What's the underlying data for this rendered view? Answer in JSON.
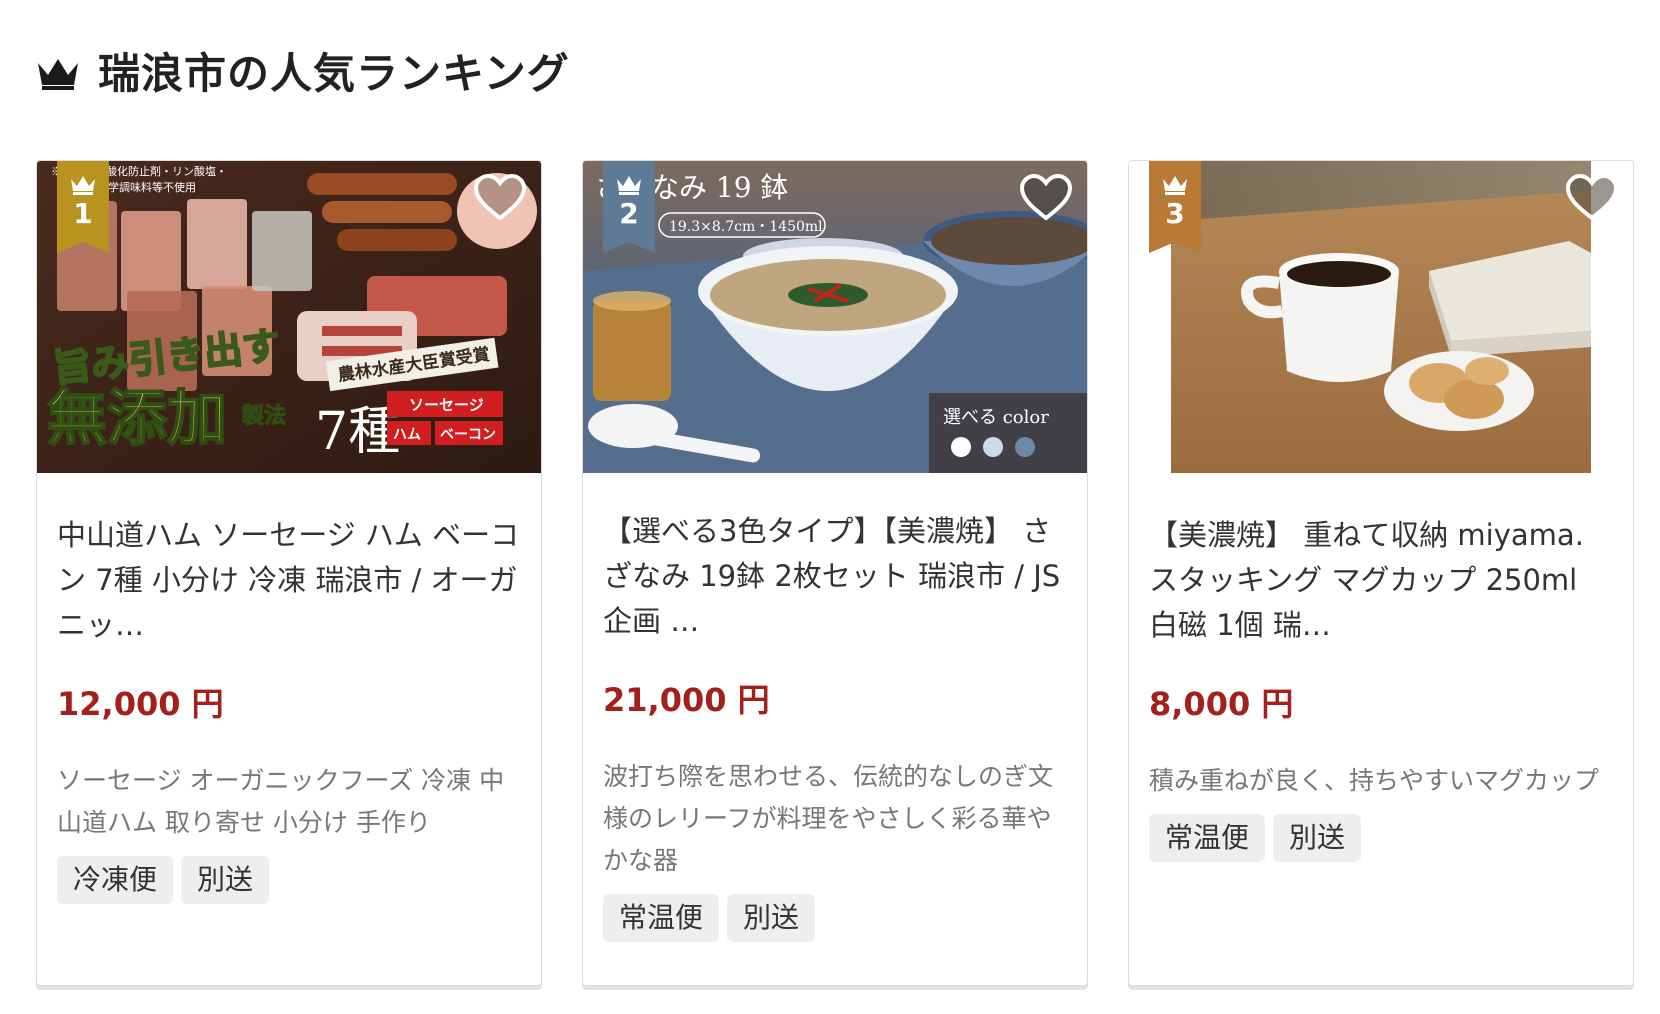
{
  "section": {
    "title": "瑞浪市の人気ランキング",
    "icon": "crown-icon"
  },
  "colors": {
    "price": "#a3201c",
    "rank1": "#b8931f",
    "rank2": "#5f7a95",
    "rank3": "#b87a34"
  },
  "cards": [
    {
      "rank": "1",
      "image_overlay": {
        "top_note": "※保存料・酸化防止剤・リン酸塩・\n化学調味料等不使用",
        "headline_1": "旨み引き出す",
        "headline_2": "無添加",
        "headline_3": "製法",
        "award": "農林水産大臣賞受賞",
        "count": "7種",
        "label_1": "ソーセージ",
        "label_2": "ハム",
        "label_3": "ベーコン"
      },
      "title": "中山道ハム ソーセージ ハム ベーコン 7種 小分け 冷凍 瑞浪市 / オーガニッ…",
      "price": "12,000 円",
      "description": "ソーセージ オーガニックフーズ 冷凍 中山道ハム 取り寄せ 小分け 手作り",
      "tags": [
        "冷凍便",
        "別送"
      ]
    },
    {
      "rank": "2",
      "image_overlay": {
        "name": "さざなみ 19 鉢",
        "size": "19.3×8.7cm・1450ml",
        "color_label": "選べる color"
      },
      "title": "【選べる3色タイプ】【美濃焼】 さざなみ 19鉢 2枚セット 瑞浪市 / JS企画 …",
      "price": "21,000 円",
      "description": "波打ち際を思わせる、伝統的なしのぎ文様のレリーフが料理をやさしく彩る華やかな器",
      "tags": [
        "常温便",
        "別送"
      ]
    },
    {
      "rank": "3",
      "image_overlay": {},
      "title": "【美濃焼】 重ねて収納 miyama. スタッキング マグカップ 250ml 白磁 1個 瑞…",
      "price": "8,000 円",
      "description": "積み重ねが良く、持ちやすいマグカップ",
      "tags": [
        "常温便",
        "別送"
      ]
    }
  ]
}
